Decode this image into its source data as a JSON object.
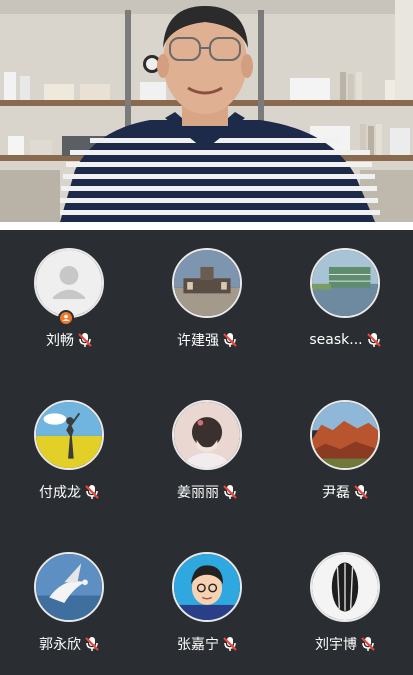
{
  "participants": [
    {
      "name": "刘畅",
      "avatar": "default-person-icon",
      "mic": "muted",
      "badge": "host"
    },
    {
      "name": "许建强",
      "avatar": "building-photo",
      "mic": "muted"
    },
    {
      "name": "seask...",
      "avatar": "glass-building-photo",
      "mic": "muted"
    },
    {
      "name": "付成龙",
      "avatar": "flower-field-photo",
      "mic": "muted"
    },
    {
      "name": "姜丽丽",
      "avatar": "girl-illustration",
      "mic": "muted"
    },
    {
      "name": "尹磊",
      "avatar": "canyon-photo",
      "mic": "muted"
    },
    {
      "name": "郭永欣",
      "avatar": "bird-photo",
      "mic": "muted"
    },
    {
      "name": "张嘉宁",
      "avatar": "cartoon-boy",
      "mic": "muted"
    },
    {
      "name": "刘宇博",
      "avatar": "sunflower-seed",
      "mic": "muted"
    }
  ],
  "colors": {
    "background": "#2a2d31",
    "mute_red": "#e8453c",
    "host_badge": "#f0792a"
  }
}
